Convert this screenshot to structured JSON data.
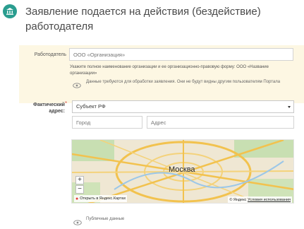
{
  "header": {
    "title": "Заявление подается на действия (бездействие) работодателя",
    "icon": "building-columns-icon",
    "icon_color": "#2a9d8f"
  },
  "employer": {
    "label": "Работодатель",
    "placeholder": "ООО «Организация»",
    "hint": "Укажите полное наименование организации и ее организационно-правовую форму: ООО «Название организации»",
    "privacy_note": "Данные требуются для обработки заявления. Они не будут видны другим пользователям Портала"
  },
  "address": {
    "label": "Фактический адрес:",
    "required_mark": "*",
    "subject_selected": "Субъект РФ",
    "city_placeholder": "Город",
    "street_placeholder": "Адрес"
  },
  "map": {
    "city_label": "Москва",
    "open_link": "Открыть в Яндекс.Картах",
    "provider": "Яндекс",
    "terms": "Условия использования",
    "zoom_in": "+",
    "zoom_out": "−"
  },
  "public_note": "Публичные данные",
  "colors": {
    "panel_bg": "#fdf7e3",
    "required": "#d9534f",
    "link": "#1a5ec2"
  }
}
